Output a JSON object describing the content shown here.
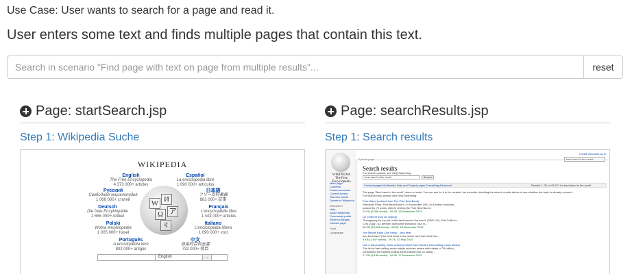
{
  "usecase": "Use Case: User wants to search for a page and read it.",
  "scenario_title": "User enters some text and finds multiple pages that contain this text.",
  "search": {
    "placeholder": "Search in scenario \"Find page with text on page from multiple results\"...",
    "reset_label": "reset"
  },
  "pages": [
    {
      "heading": "Page: startSearch.jsp",
      "step": "Step 1: Wikipedia Suche"
    },
    {
      "heading": "Page: searchResults.jsp",
      "step": "Step 1: Search results"
    }
  ],
  "wikipedia_portal": {
    "title": "WIKIPEDIA",
    "languages": [
      {
        "name": "English",
        "subtitle": "The Free Encyclopedia",
        "count": "4 373 000+ articles"
      },
      {
        "name": "Español",
        "subtitle": "La enciclopedia libre",
        "count": "1 090 000+ artículos"
      },
      {
        "name": "Русский",
        "subtitle": "Свободная энциклопедия",
        "count": "1 066 000+ статей"
      },
      {
        "name": "日本語",
        "subtitle": "フリー百科事典",
        "count": "881 000+ 記事"
      },
      {
        "name": "Deutsch",
        "subtitle": "Die freie Enzyklopädie",
        "count": "1 655 000+ Artikel"
      },
      {
        "name": "Français",
        "subtitle": "L'encyclopédie libre",
        "count": "1 443 000+ articles"
      },
      {
        "name": "Polski",
        "subtitle": "Wolna encyklopedia",
        "count": "1 005 000+ haseł"
      },
      {
        "name": "Italiano",
        "subtitle": "L'enciclopedia libera",
        "count": "1 090 000+ voci"
      },
      {
        "name": "Português",
        "subtitle": "A enciclopédia livre",
        "count": "802 000+ artigos"
      },
      {
        "name": "中文",
        "subtitle": "自由的百科全書",
        "count": "732 000+ 條目"
      }
    ],
    "select_value": "English",
    "go_label": "→"
  },
  "results_page": {
    "logo_title": "WIKIPEDIA",
    "logo_subtitle": "The Free Encyclopedia",
    "special": "Special page",
    "top_links": [
      "Create account",
      "Log in"
    ],
    "top_search": "best band in the world",
    "heading": "Search results",
    "for_search_options": "For search options, see Help:Searching",
    "query": "best band in the world",
    "search_btn": "Search",
    "filter_bar": "Content pages   Multimedia   Help and Project pages   Everything   Advanced",
    "results_count": "Results 1–20 of 42,671 for best band in the world",
    "nav": [
      "Main page",
      "Contents",
      "Featured content",
      "Current events",
      "Random article",
      "Donate to Wikipedia",
      "Interaction",
      "Help",
      "About Wikipedia",
      "Community portal",
      "Recent changes",
      "Contact page",
      "Tools",
      "Languages"
    ],
    "lines": [
      "The page \"Best band in the world\" does not exist. You can ask for it to be created, but consider checking the search results below to see whether the topic is already covered.",
      "For search help, please visit Help:Searching.",
      "Pole: Band (redirect from The Pole Best Band)",
      "Reedship Polar: Pole Best Band in 24 November 1941 in a British musician...",
      "passed for 70 years. Before retiring the Pole Best Band...",
      "13 KB (6,346 words) - 09:40, 15 November 2013",
      "U2 (redirect from U2 (band))",
      "\"Reapplying for the job of the best band in the world\" (2000–01). Phil Collins's...",
      "CHs U.jpg | U2 perform during the Elevation Tour in...",
      "96 KB (13,098 words) - 08:30, 18 November 2013",
      "Joe Beside Band (Joe band) ...and beat",
      "and beat band | the best band in the world. and then beat two...",
      "5 KB (1,947 words) - 20:26, 22 May 2013",
      "List of band-selling music artists (redirect from World's best-selling music artists)",
      "The list of best-selling music artists includes artists with claims of 75 million...",
      "considered the highest-selling band (based both on sales)...",
      "27 KB (8,158 words) - 09:30, 17 November 2013"
    ]
  }
}
